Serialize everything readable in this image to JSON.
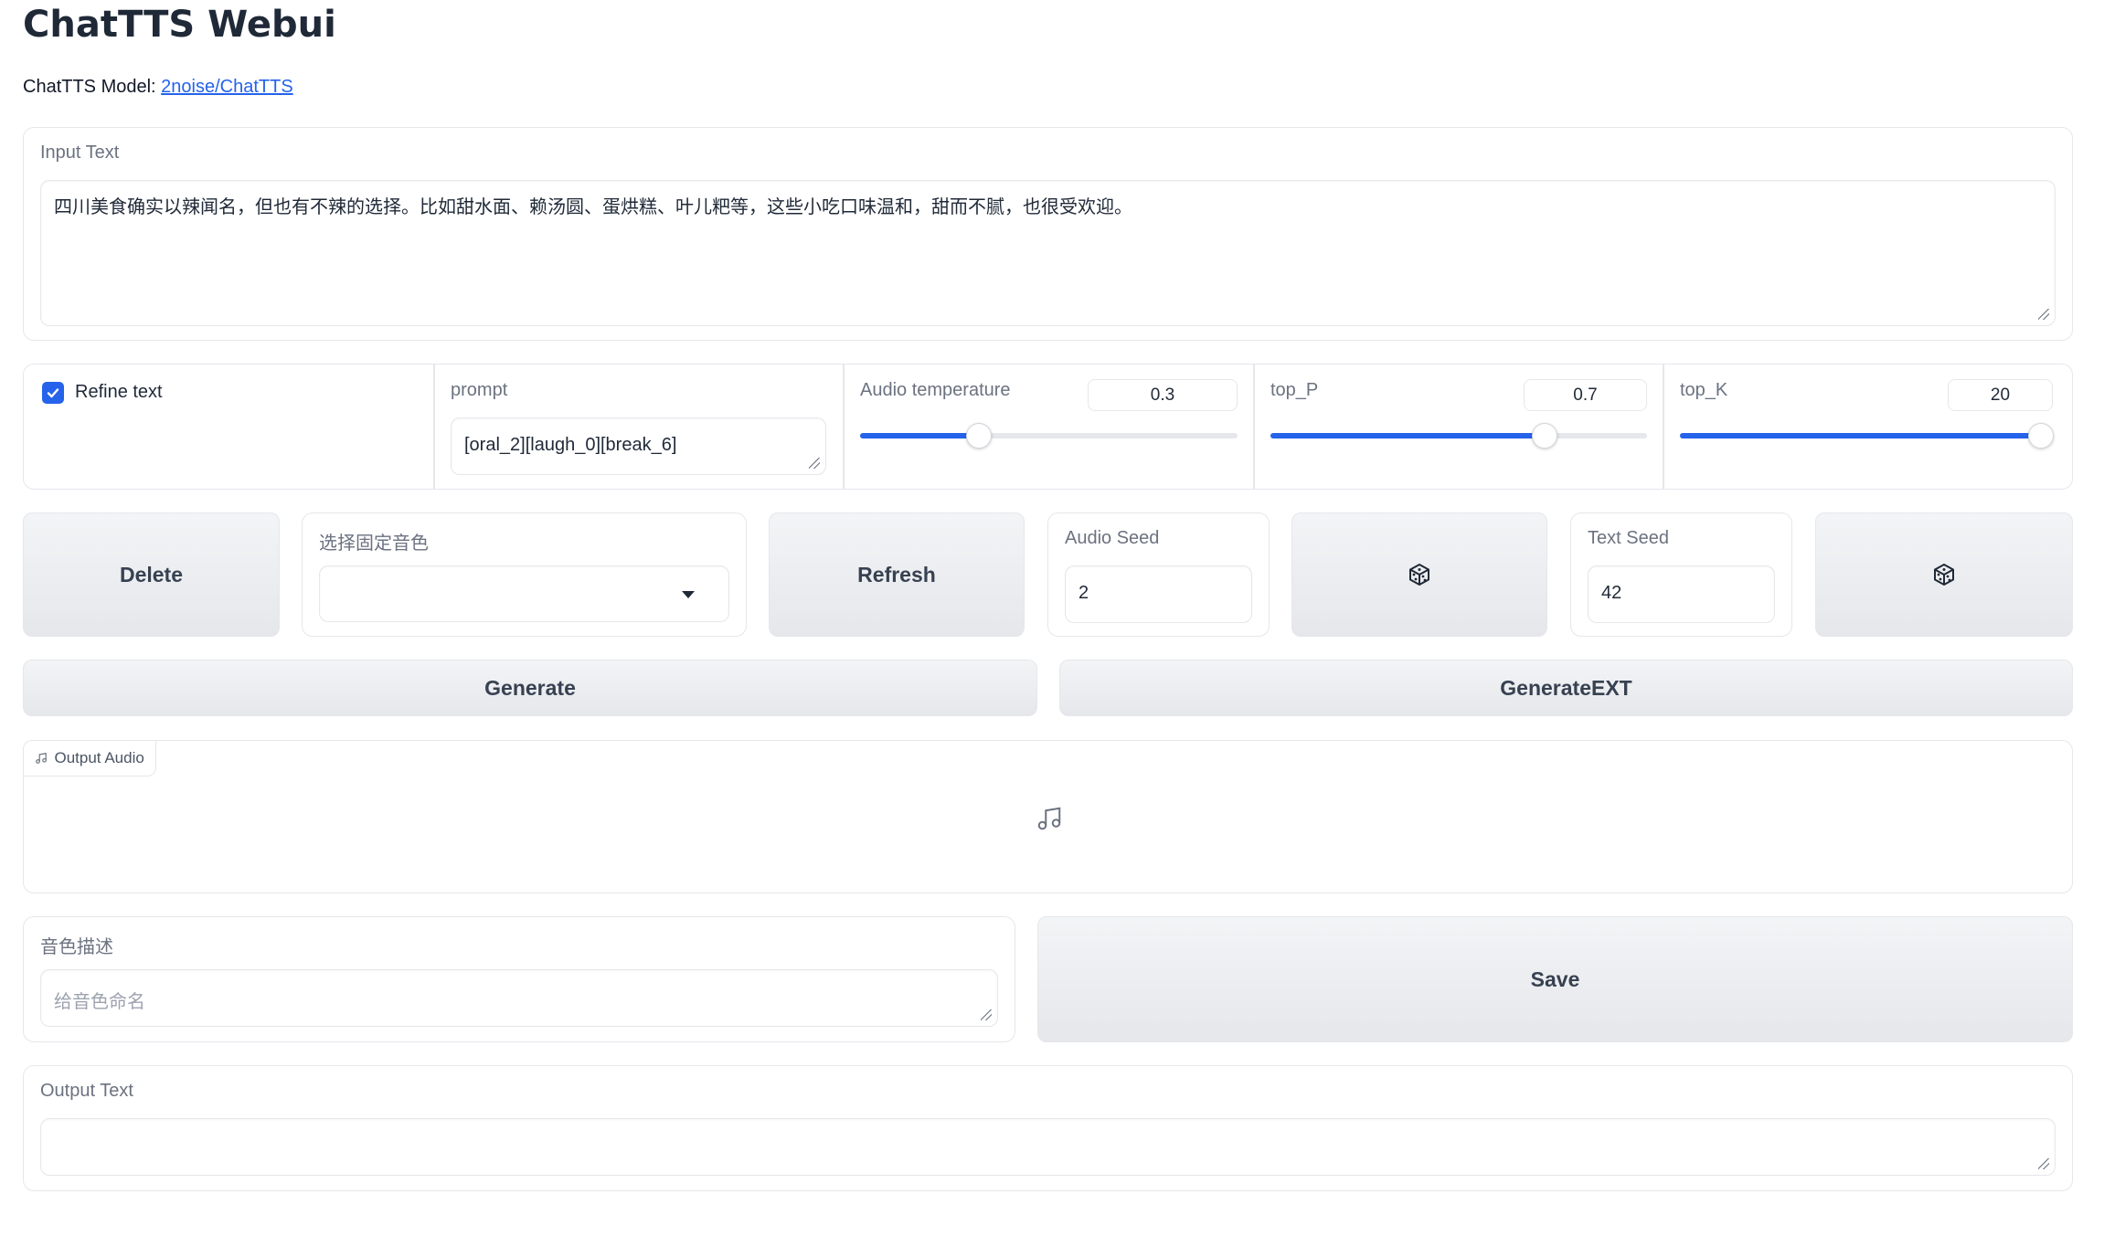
{
  "app": {
    "title": "ChatTTS Webui",
    "model_label": "ChatTTS Model:",
    "model_link": "2noise/ChatTTS"
  },
  "input_text": {
    "label": "Input Text",
    "value": "四川美食确实以辣闻名，但也有不辣的选择。比如甜水面、赖汤圆、蛋烘糕、叶儿粑等，这些小吃口味温和，甜而不腻，也很受欢迎。"
  },
  "controls": {
    "refine_text": {
      "label": "Refine text",
      "checked": true
    },
    "prompt": {
      "label": "prompt",
      "value": "[oral_2][laugh_0][break_6]"
    },
    "audio_temperature": {
      "label": "Audio temperature",
      "value": "0.3",
      "fraction": 0.315
    },
    "top_p": {
      "label": "top_P",
      "value": "0.7",
      "fraction": 0.727
    },
    "top_k": {
      "label": "top_K",
      "value": "20",
      "fraction": 1.0
    }
  },
  "row3": {
    "delete_label": "Delete",
    "voice_select": {
      "label": "选择固定音色",
      "value": ""
    },
    "refresh_label": "Refresh",
    "audio_seed": {
      "label": "Audio Seed",
      "value": "2"
    },
    "text_seed": {
      "label": "Text Seed",
      "value": "42"
    },
    "dice_icon": "dice-icon"
  },
  "actions": {
    "generate_label": "Generate",
    "generate_ext_label": "GenerateEXT"
  },
  "output_audio": {
    "label": "Output Audio",
    "icon": "music-note-icon"
  },
  "voice_desc": {
    "label": "音色描述",
    "placeholder": "给音色命名",
    "save_label": "Save"
  },
  "output_text": {
    "label": "Output Text",
    "value": ""
  },
  "colors": {
    "accent": "#2563eb",
    "border": "#e5e7eb",
    "button_bg": "#e5e7eb"
  }
}
